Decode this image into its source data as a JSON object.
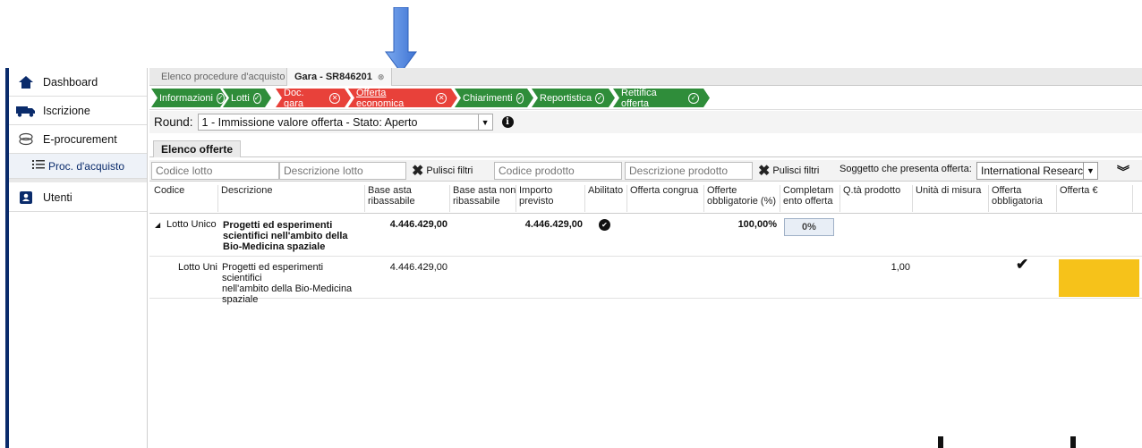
{
  "sidebar": {
    "items": [
      {
        "label": "Dashboard",
        "icon": "home-icon"
      },
      {
        "label": "Iscrizione",
        "icon": "truck-icon"
      },
      {
        "label": "E-procurement",
        "icon": "coins-icon"
      },
      {
        "label": "Proc. d'acquisto",
        "icon": "list-icon"
      },
      {
        "label": "Utenti",
        "icon": "user-card-icon"
      }
    ]
  },
  "tabs": [
    {
      "label": "Elenco procedure d'acquisto"
    },
    {
      "label": "Gara - SR846201"
    }
  ],
  "steps": [
    {
      "label": "Informazioni",
      "status": "ok"
    },
    {
      "label": "Lotti",
      "status": "ok"
    },
    {
      "label": "Doc. gara",
      "status": "error"
    },
    {
      "label": "Offerta economica",
      "status": "error"
    },
    {
      "label": "Chiarimenti",
      "status": "ok"
    },
    {
      "label": "Reportistica",
      "status": "ok"
    },
    {
      "label": "Rettifica offerta",
      "status": "ok"
    }
  ],
  "round": {
    "label": "Round:",
    "value": "1 - Immissione valore offerta - Stato: Aperto"
  },
  "subtab": {
    "label": "Elenco offerte"
  },
  "filters": {
    "codice_lotto_placeholder": "Codice lotto",
    "descrizione_lotto_placeholder": "Descrizione lotto",
    "pulisci_1": "Pulisci filtri",
    "codice_prodotto_placeholder": "Codice prodotto",
    "descrizione_prodotto_placeholder": "Descrizione prodotto",
    "pulisci_2": "Pulisci filtri",
    "soggetto_label": "Soggetto che presenta offerta:",
    "soggetto_value": "International Research !"
  },
  "columns": [
    "Codice",
    "Descrizione",
    "Base asta ribassabile",
    "Base asta non ribassabile",
    "Importo previsto",
    "Abilitato",
    "Offerta congrua",
    "Offerte obbligatorie (%)",
    "Completamento offerta",
    "Q.tà prodotto",
    "Unità di misura",
    "Offerta obbligatoria",
    "Offerta €"
  ],
  "columns_display": {
    "c0": "Codice",
    "c1": "Descrizione",
    "c2a": "Base asta",
    "c2b": "ribassabile",
    "c3a": "Base asta non",
    "c3b": "ribassabile",
    "c4a": "Importo",
    "c4b": "previsto",
    "c5": "Abilitato",
    "c6": "Offerta congrua",
    "c7a": "Offerte",
    "c7b": "obbligatorie (%)",
    "c8a": "Completam",
    "c8b": "ento offerta",
    "c9": "Q.tà prodotto",
    "c10": "Unità di misura",
    "c11a": "Offerta",
    "c11b": "obbligatoria",
    "c12": "Offerta €"
  },
  "rows": [
    {
      "toggle": "◢",
      "codice": "Lotto Unico",
      "descrizione_l1": "Progetti ed esperimenti",
      "descrizione_l2": "scientifici nell'ambito della",
      "descrizione_l3": "Bio-Medicina spaziale",
      "base_asta": "4.446.429,00",
      "importo": "4.446.429,00",
      "abilitato": true,
      "offerte_obbligatorie": "100,00%",
      "completamento": "0%"
    },
    {
      "codice": "Lotto Uni",
      "descrizione_l1": "Progetti ed esperimenti scientifici",
      "descrizione_l2": "nell'ambito della Bio-Medicina",
      "descrizione_l3": "spaziale",
      "base_asta": "4.446.429,00",
      "qta": "1,00",
      "offerta_obbligatoria": true
    }
  ],
  "colors": {
    "step_ok": "#2f8d3a",
    "step_error": "#e8413a",
    "offer_cell": "#f6c21a",
    "arrow": "#5b8fe0",
    "sidebar_accent": "#0a2b6b"
  }
}
